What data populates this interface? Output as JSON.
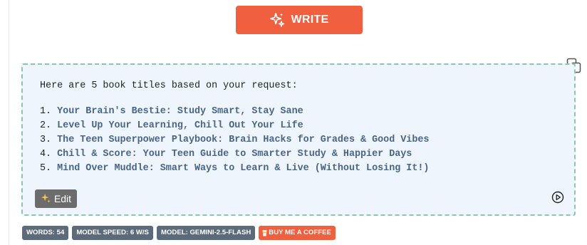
{
  "write_button": {
    "label": "WRITE",
    "icon": "sparkles-icon"
  },
  "result": {
    "intro": "Here are 5 book titles based on your request:",
    "titles": [
      {
        "num": "1.",
        "text": "Your Brain's Bestie: Study Smart, Stay Sane"
      },
      {
        "num": "2.",
        "text": "Level Up Your Learning, Chill Out Your Life"
      },
      {
        "num": "3.",
        "text": "The Teen Superpower Playbook: Brain Hacks for Grades & Good Vibes"
      },
      {
        "num": "4.",
        "text": "Chill & Score: Your Teen Guide to Smarter Study & Happier Days"
      },
      {
        "num": "5.",
        "text": "Mind Over Muddle: Smart Ways to Learn & Live (Without Losing It!)"
      }
    ],
    "edit_label": "Edit"
  },
  "stats": {
    "words": "WORDS: 54",
    "model_speed": "MODEL SPEED: 6 W/S",
    "model": "MODEL: GEMINI-2.5-FLASH",
    "coffee": "BUY ME A COFFEE"
  },
  "colors": {
    "accent": "#f05f3e",
    "box_bg": "#eef5fd",
    "box_border": "#8dc4b2",
    "title_text": "#4a6484",
    "badge_bg": "#5c6b7c",
    "edit_bg": "#6c6c6c"
  }
}
